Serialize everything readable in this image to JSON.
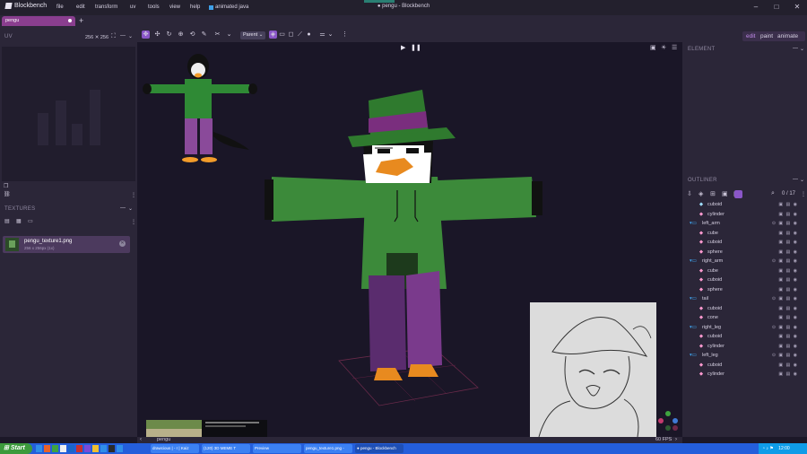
{
  "app": {
    "name": "Blockbench",
    "window_title": "● pengu - Blockbench"
  },
  "menu": [
    "file",
    "edit",
    "transform",
    "uv",
    "tools",
    "view",
    "help"
  ],
  "menu_extra": "animated java",
  "tabs": [
    {
      "label": "pengu"
    }
  ],
  "uv_panel": {
    "title": "UV",
    "size": "256 ✕ 256"
  },
  "textures_panel": {
    "title": "TEXTURES",
    "texture_name": "pengu_texture1.png",
    "texture_meta": "256 x 256px (1x)"
  },
  "toolbar": {
    "pivot_select": "Parent"
  },
  "modes": [
    "edit",
    "paint",
    "animate"
  ],
  "element_panel": {
    "title": "ELEMENT"
  },
  "outliner": {
    "title": "OUTLINER",
    "count": "0 / 17",
    "rows": [
      {
        "label": "cuboid",
        "type": "cube",
        "indent": 2
      },
      {
        "label": "cylinder",
        "type": "mesh",
        "indent": 2
      },
      {
        "label": "left_arm",
        "type": "group",
        "indent": 1
      },
      {
        "label": "cube",
        "type": "mesh",
        "indent": 2
      },
      {
        "label": "cuboid",
        "type": "mesh",
        "indent": 2
      },
      {
        "label": "sphere",
        "type": "mesh",
        "indent": 2
      },
      {
        "label": "right_arm",
        "type": "group",
        "indent": 1
      },
      {
        "label": "cube",
        "type": "mesh",
        "indent": 2
      },
      {
        "label": "cuboid",
        "type": "mesh",
        "indent": 2
      },
      {
        "label": "sphere",
        "type": "mesh",
        "indent": 2
      },
      {
        "label": "tail",
        "type": "group",
        "indent": 1
      },
      {
        "label": "cuboid",
        "type": "mesh",
        "indent": 2
      },
      {
        "label": "cone",
        "type": "mesh",
        "indent": 2
      },
      {
        "label": "right_leg",
        "type": "group",
        "indent": 1
      },
      {
        "label": "cuboid",
        "type": "mesh",
        "indent": 2
      },
      {
        "label": "cylinder",
        "type": "mesh",
        "indent": 2
      },
      {
        "label": "left_leg",
        "type": "group",
        "indent": 1
      },
      {
        "label": "cuboid",
        "type": "mesh",
        "indent": 2
      },
      {
        "label": "cylinder",
        "type": "mesh",
        "indent": 2
      }
    ]
  },
  "statusbar": {
    "model_name": "pengu",
    "fps": "60 FPS"
  },
  "taskbar": {
    "start": "Start",
    "tasks": [
      "drawcious | - r | Kaiz",
      "(120) 3D MEME T",
      "Preview",
      "pengu_texture1.png - ",
      "● pengu - Blockbench"
    ],
    "clock": "12:00"
  },
  "colors": {
    "accent": "#8a3e8f",
    "mode_active": "#a46bd8",
    "viewport_bg": "#1a1627"
  }
}
